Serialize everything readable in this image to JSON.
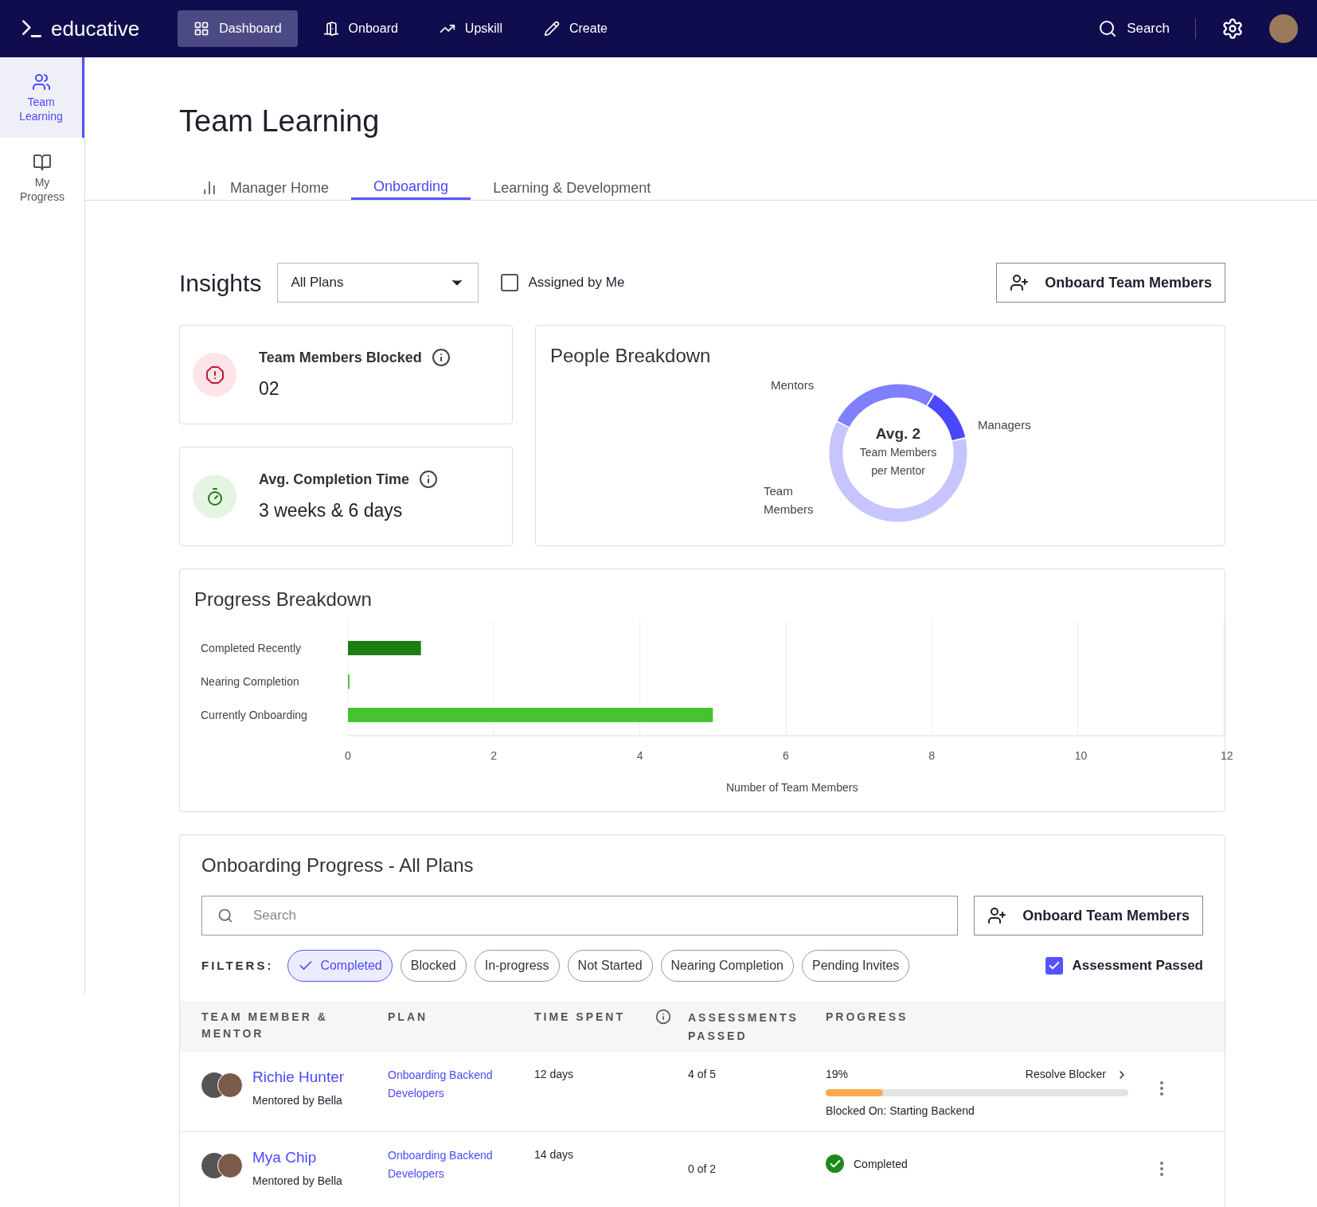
{
  "nav": {
    "logo": "educative",
    "items": [
      {
        "label": "Dashboard",
        "selected": true,
        "kind": "grid"
      },
      {
        "label": "Onboard",
        "selected": false,
        "kind": "door"
      },
      {
        "label": "Upskill",
        "selected": false,
        "kind": "trend"
      },
      {
        "label": "Create",
        "selected": false,
        "kind": "pencil"
      }
    ],
    "search": "Search"
  },
  "sidebar": {
    "items": [
      {
        "label": "Team Learning",
        "selected": true,
        "kind": "people"
      },
      {
        "label": "My Progress",
        "selected": false,
        "kind": "book"
      }
    ]
  },
  "page": {
    "title": "Team Learning"
  },
  "tabs": [
    {
      "label": "Manager Home",
      "selected": false,
      "icon": true
    },
    {
      "label": "Onboarding",
      "selected": true,
      "icon": false
    },
    {
      "label": "Learning & Development",
      "selected": false,
      "icon": false
    }
  ],
  "insights": {
    "title": "Insights",
    "dropdown": "All Plans",
    "assigned": {
      "label": "Assigned by Me",
      "checked": false
    },
    "button": "Onboard Team Members"
  },
  "stats": [
    {
      "label": "Team Members Blocked",
      "value": "02",
      "kind": "blocked"
    },
    {
      "label": "Avg. Completion Time",
      "value": "3 weeks & 6 days",
      "kind": "time"
    }
  ],
  "people": {
    "title": "People Breakdown",
    "labels": [
      "Mentors",
      "Managers",
      "Team Members"
    ],
    "center_title": "Avg. 2",
    "center_text": "Team Members per Mentor"
  },
  "progress": {
    "title": "Progress Breakdown",
    "chart_data": {
      "type": "bar",
      "orientation": "horizontal",
      "grid": true,
      "xlabel": "Number of Team Members",
      "categories": [
        "Completed Recently",
        "Nearing Completion",
        "Currently Onboarding"
      ],
      "values": [
        1,
        0,
        5
      ],
      "colors": [
        "#1e7d12",
        "#4ac43a",
        "#46c42f"
      ],
      "xlim": [
        0,
        12
      ],
      "xticks": [
        0,
        2,
        4,
        6,
        8,
        10,
        12
      ]
    }
  },
  "onboarding": {
    "title": "Onboarding Progress - All Plans",
    "search_placeholder": "Search",
    "button": "Onboard Team Members",
    "filters_label": "FILTERS:",
    "filters": [
      {
        "label": "Completed",
        "selected": true
      },
      {
        "label": "Blocked",
        "selected": false
      },
      {
        "label": "In-progress",
        "selected": false
      },
      {
        "label": "Not Started",
        "selected": false
      },
      {
        "label": "Nearing Completion",
        "selected": false
      },
      {
        "label": "Pending Invites",
        "selected": false
      }
    ],
    "assessment": {
      "label": "Assessment Passed",
      "checked": true
    },
    "columns": [
      "TEAM MEMBER & MENTOR",
      "PLAN",
      "TIME SPENT",
      "ASSESSMENTS PASSED",
      "PROGRESS"
    ],
    "rows": [
      {
        "name": "Richie Hunter",
        "mentor": "Mentored by Bella",
        "plan": "Onboarding Backend Developers",
        "time": "12 days",
        "assessments": "4 of 5",
        "kind": "blocked",
        "percent": "19%",
        "level": 0.19,
        "action": "Resolve Blocker",
        "note": "Blocked On: Starting Backend"
      },
      {
        "name": "Mya Chip",
        "mentor": "Mentored by Bella",
        "plan": "Onboarding Backend Developers",
        "time": "14 days",
        "assessments": "0 of 2",
        "kind": "completed",
        "status": "Completed"
      }
    ]
  }
}
